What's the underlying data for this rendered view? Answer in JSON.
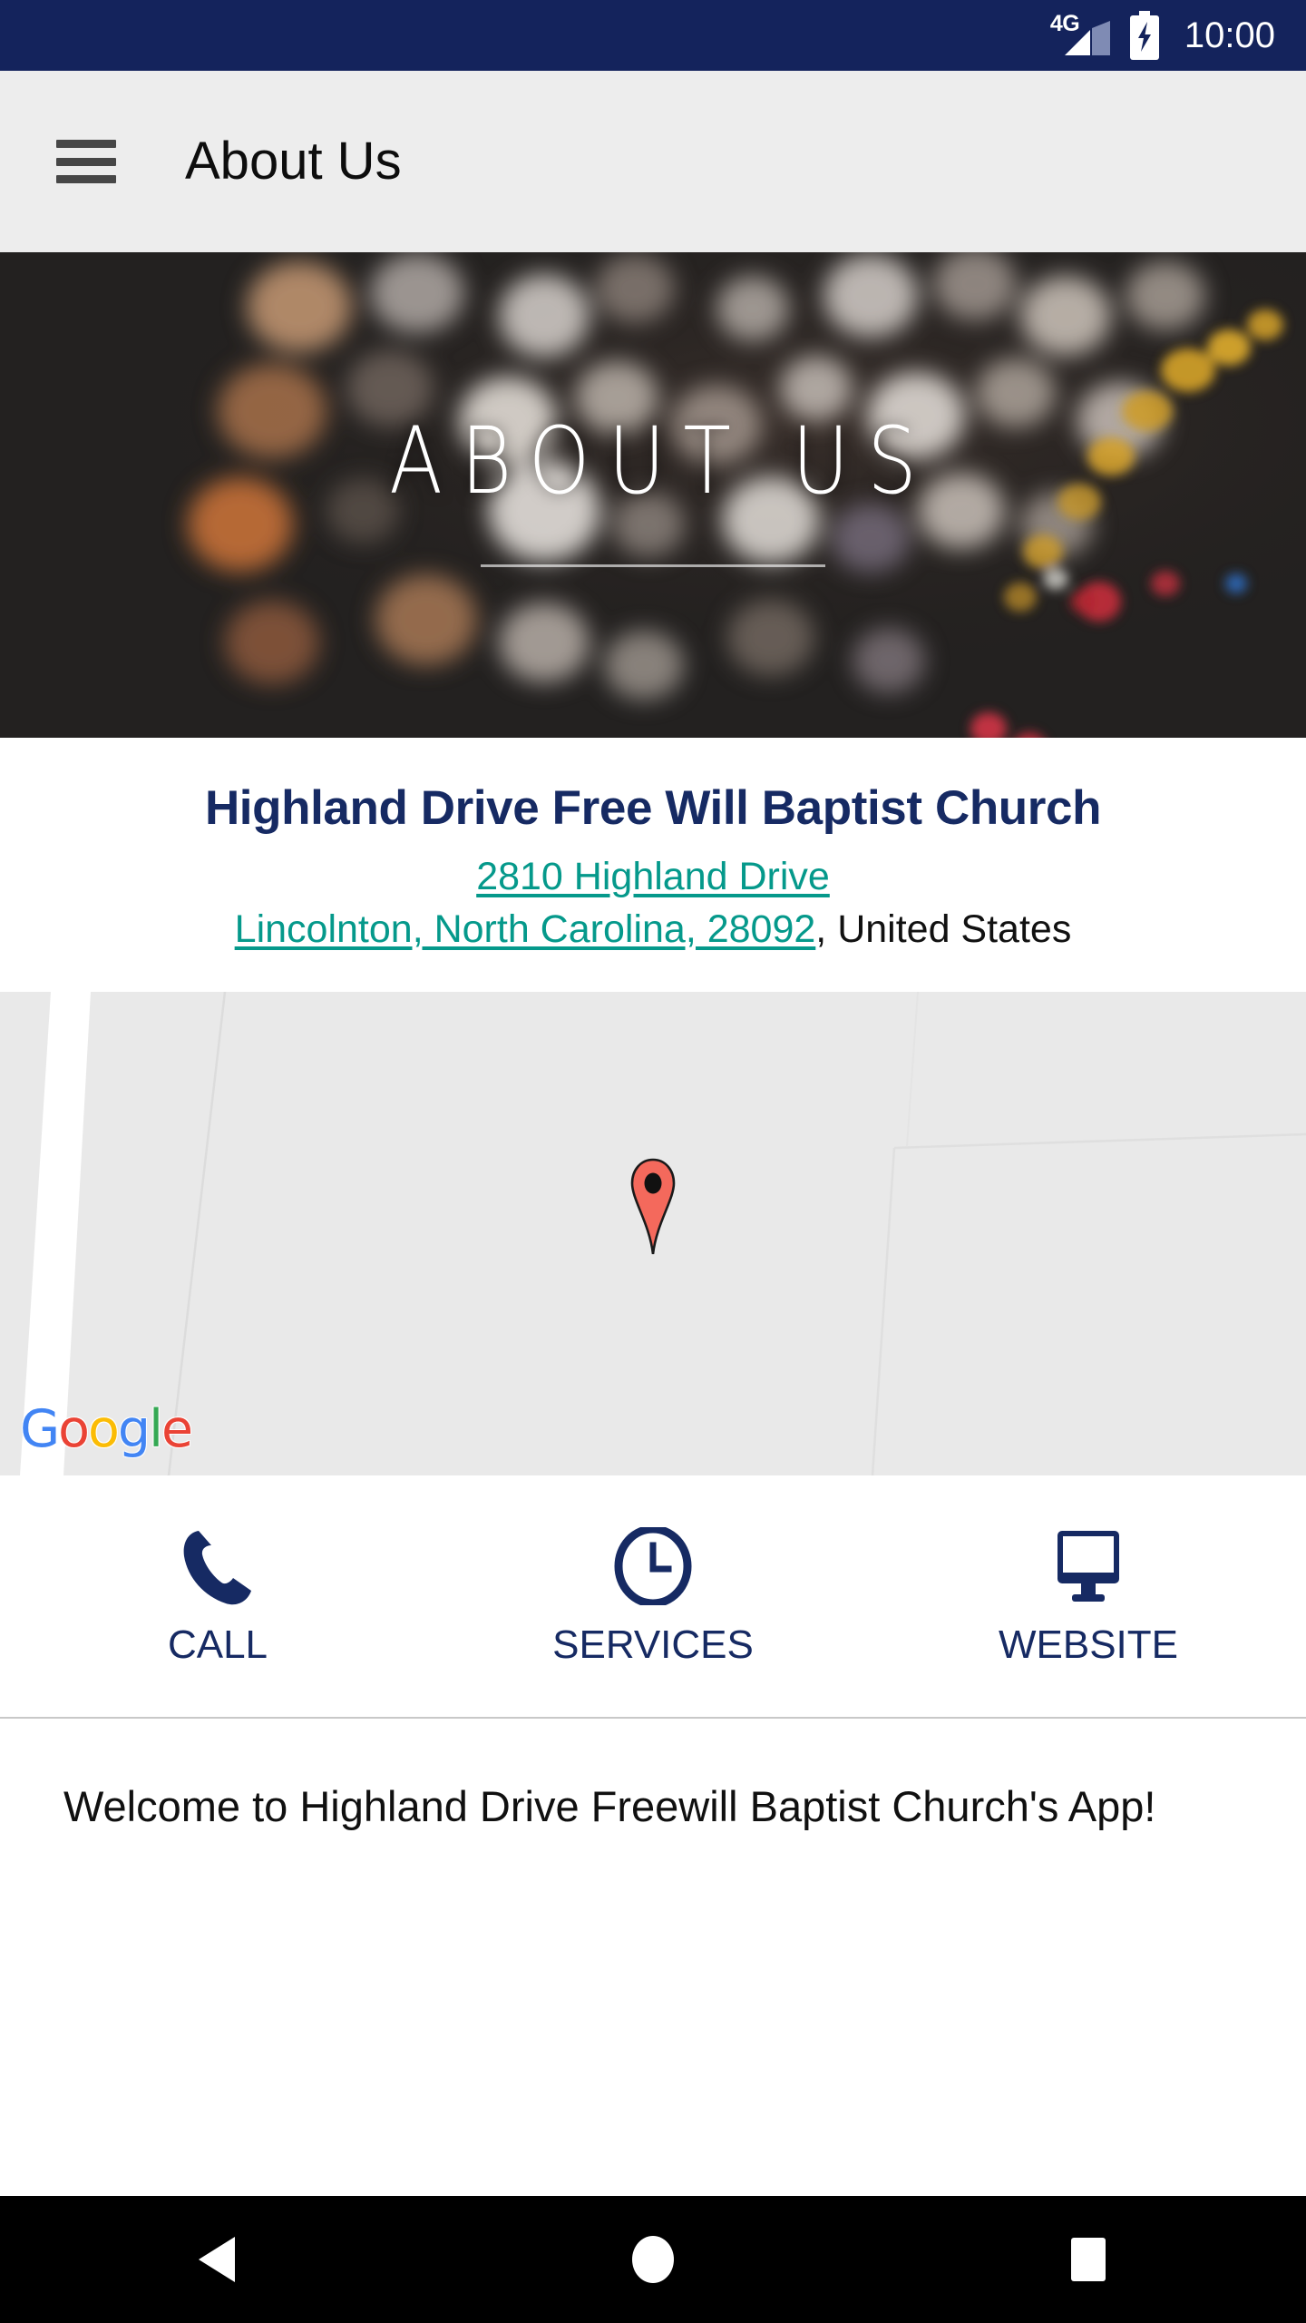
{
  "status_bar": {
    "network_label": "4G",
    "time": "10:00",
    "battery_state": "charging",
    "background_color": "#14235c"
  },
  "app_bar": {
    "menu_icon": "hamburger-menu-icon",
    "title": "About Us",
    "background_color": "#ededed"
  },
  "hero": {
    "title": "ABOUT US",
    "background_description": "dark blurred bokeh lights"
  },
  "info": {
    "org_name": "Highland Drive Free Will Baptist Church",
    "address_line1": "2810 Highland Drive",
    "address_line2": "Lincolnton, North Carolina, 28092",
    "address_country": ", United States",
    "org_name_color": "#162a63",
    "link_color": "#05998b"
  },
  "map": {
    "provider_watermark": "Google",
    "watermark_letters": [
      "G",
      "o",
      "o",
      "g",
      "l",
      "e"
    ],
    "marker": "map-pin-marker",
    "marker_color": "#f4695c"
  },
  "actions": {
    "accent_color": "#162a63",
    "items": [
      {
        "label": "CALL",
        "icon": "phone-icon"
      },
      {
        "label": "SERVICES",
        "icon": "clock-icon"
      },
      {
        "label": "WEBSITE",
        "icon": "monitor-icon"
      }
    ]
  },
  "welcome": {
    "text": "Welcome to Highland Drive Freewill Baptist Church's App!"
  },
  "nav_bar": {
    "back_label": "Back",
    "home_label": "Home",
    "recents_label": "Recents"
  }
}
